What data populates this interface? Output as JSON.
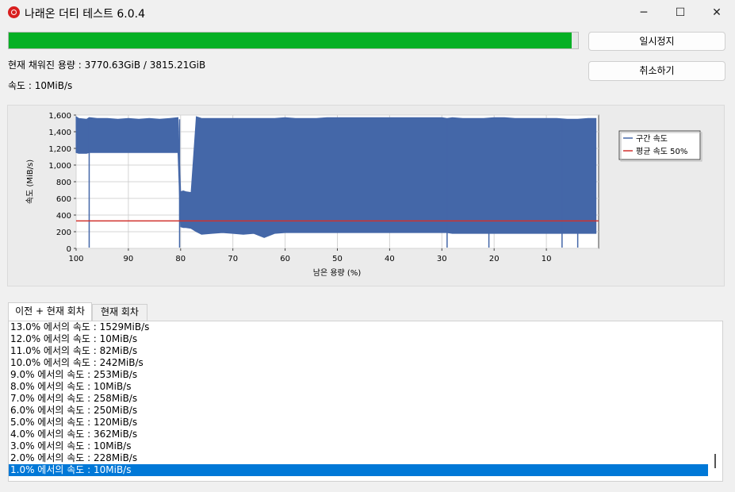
{
  "window": {
    "title": "나래온 더티 테스트 6.0.4",
    "minimize_icon": "minimize-icon",
    "maximize_icon": "maximize-icon",
    "close_icon": "close-icon",
    "minimize_glyph": "─",
    "maximize_glyph": "☐",
    "close_glyph": "✕"
  },
  "progress": {
    "fraction": 0.9883,
    "color": "#06b025"
  },
  "buttons": {
    "pause": "일시정지",
    "cancel": "취소하기"
  },
  "status": {
    "capacity_label": "현재 채워진 용량 : 3770.63GiB / 3815.21GiB",
    "speed_label": "속도 : 10MiB/s"
  },
  "chart_data": {
    "type": "area",
    "xlabel": "남은 용량 (%)",
    "ylabel": "속도 (MiB/s)",
    "xlim": [
      100,
      0
    ],
    "ylim": [
      0,
      1600
    ],
    "xticks": [
      "100",
      "90",
      "80",
      "70",
      "60",
      "50",
      "40",
      "30",
      "20",
      "10"
    ],
    "yticks": [
      "0",
      "200",
      "400",
      "600",
      "800",
      "1,000",
      "1,200",
      "1,400",
      "1,600"
    ],
    "grid": true,
    "legend_position": "right",
    "series": [
      {
        "name": "구간 속도",
        "color": "#4467a8",
        "x": [
          100,
          99.5,
          98,
          97.5,
          96,
          94,
          92,
          90,
          88,
          86,
          84,
          82,
          80.5,
          80,
          79.5,
          79,
          78,
          77,
          76,
          74,
          72,
          70,
          68,
          66,
          64,
          62,
          60,
          58,
          56,
          54,
          52,
          50,
          48,
          46,
          44,
          42,
          40,
          38,
          36,
          34,
          32,
          30,
          29,
          28,
          26,
          24,
          22,
          20,
          18,
          16,
          14,
          12,
          10,
          8,
          6,
          4,
          2,
          0.5
        ],
        "values": [
          1580,
          1560,
          1550,
          1570,
          1560,
          1560,
          1550,
          1560,
          1550,
          1560,
          1550,
          1560,
          1570,
          680,
          690,
          680,
          670,
          1580,
          1560,
          1560,
          1560,
          1560,
          1560,
          1560,
          1560,
          1560,
          1570,
          1560,
          1560,
          1560,
          1570,
          1570,
          1570,
          1570,
          1570,
          1570,
          1570,
          1570,
          1570,
          1570,
          1570,
          1570,
          1560,
          1570,
          1560,
          1560,
          1560,
          1570,
          1570,
          1560,
          1560,
          1560,
          1560,
          1560,
          1550,
          1550,
          1560,
          1560
        ],
        "lower_band": [
          1150,
          1140,
          1140,
          1150,
          1150,
          1150,
          1150,
          1150,
          1150,
          1150,
          1150,
          1150,
          1150,
          260,
          250,
          250,
          240,
          200,
          170,
          180,
          190,
          180,
          170,
          180,
          130,
          180,
          190,
          190,
          190,
          190,
          190,
          190,
          190,
          190,
          190,
          190,
          190,
          190,
          190,
          190,
          190,
          190,
          190,
          180,
          180,
          180,
          180,
          180,
          180,
          180,
          180,
          180,
          180,
          180,
          180,
          180,
          180,
          180
        ]
      },
      {
        "name": "평균 속도 50%",
        "color": "#d0312d",
        "constant": 330
      }
    ]
  },
  "tabs": [
    {
      "label": "이전 + 현재 회차",
      "active": true
    },
    {
      "label": "현재 회차",
      "active": false
    }
  ],
  "log": [
    "13.0% 에서의 속도 : 1529MiB/s",
    "12.0% 에서의 속도 : 10MiB/s",
    "11.0% 에서의 속도 : 82MiB/s",
    "10.0% 에서의 속도 : 242MiB/s",
    "9.0% 에서의 속도 : 253MiB/s",
    "8.0% 에서의 속도 : 10MiB/s",
    "7.0% 에서의 속도 : 258MiB/s",
    "6.0% 에서의 속도 : 250MiB/s",
    "5.0% 에서의 속도 : 120MiB/s",
    "4.0% 에서의 속도 : 362MiB/s",
    "3.0% 에서의 속도 : 10MiB/s",
    "2.0% 에서의 속도 : 228MiB/s",
    "1.0% 에서의 속도 : 10MiB/s"
  ],
  "selected_log_index": 12
}
